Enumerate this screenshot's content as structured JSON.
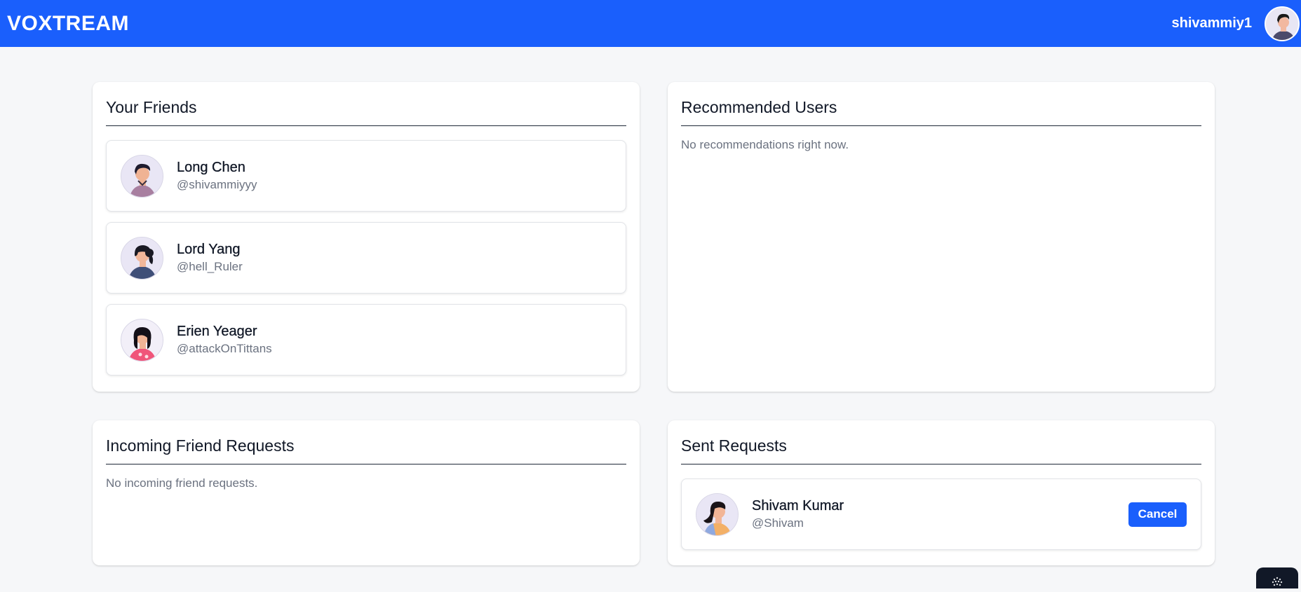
{
  "header": {
    "brand": "VOXTREAM",
    "username": "shivammiy1",
    "bg_color": "#1a5ffc"
  },
  "friends": {
    "title": "Your Friends",
    "items": [
      {
        "name": "Long Chen",
        "handle": "@shivammiyyy",
        "avatar_icon": "avatar-man-illustration-icon"
      },
      {
        "name": "Lord Yang",
        "handle": "@hell_Ruler",
        "avatar_icon": "avatar-woman-dark-top-icon"
      },
      {
        "name": "Erien Yeager",
        "handle": "@attackOnTittans",
        "avatar_icon": "avatar-woman-pink-top-icon"
      }
    ]
  },
  "recommended": {
    "title": "Recommended Users",
    "empty_message": "No recommendations right now."
  },
  "incoming": {
    "title": "Incoming Friend Requests",
    "empty_message": "No incoming friend requests."
  },
  "sent": {
    "title": "Sent Requests",
    "items": [
      {
        "name": "Shivam Kumar",
        "handle": "@Shivam",
        "action_label": "Cancel",
        "avatar_icon": "avatar-woman-orange-top-icon"
      }
    ]
  },
  "colors": {
    "accent": "#1a5ffc",
    "page_bg": "#f6f7f9",
    "muted_text": "#6b7280"
  }
}
